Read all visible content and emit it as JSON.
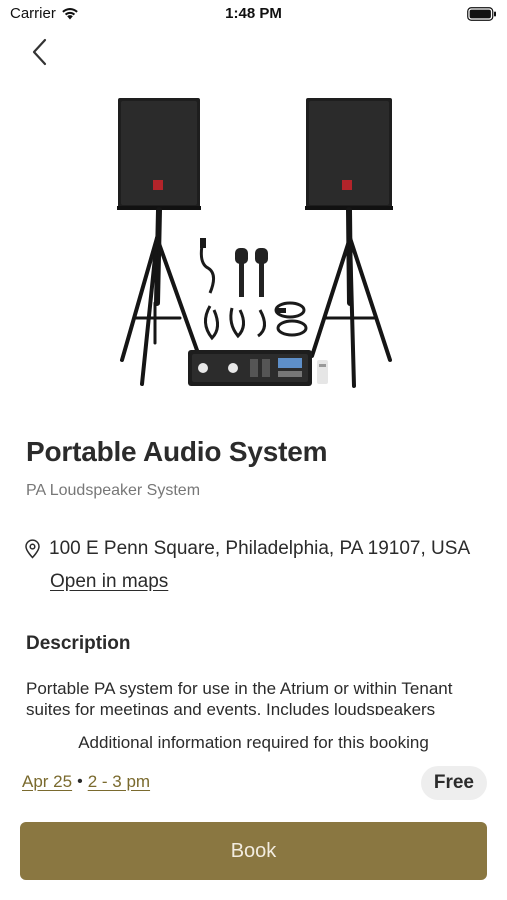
{
  "status_bar": {
    "carrier": "Carrier",
    "time": "1:48 PM"
  },
  "nav": {
    "back_icon": "chevron-left-icon"
  },
  "product": {
    "image": "pa-speaker-system-photo",
    "title": "Portable Audio System",
    "subtitle": "PA Loudspeaker System"
  },
  "location": {
    "icon": "map-pin-icon",
    "address": "100 E Penn Square, Philadelphia, PA 19107, USA",
    "maps_link": "Open in maps"
  },
  "description": {
    "heading": "Description",
    "text": "Portable PA system for use in the Atrium or within Tenant suites for meetings and events. Includes loudspeakers"
  },
  "booking": {
    "notice": "Additional information required for this booking",
    "date": "Apr 25",
    "separator": "•",
    "time_range": "2 - 3 pm",
    "price": "Free",
    "book_label": "Book"
  },
  "colors": {
    "accent": "#8a7741",
    "link": "#7a6a2e",
    "badge_bg": "#eeeeee",
    "text": "#2b2b2b"
  }
}
